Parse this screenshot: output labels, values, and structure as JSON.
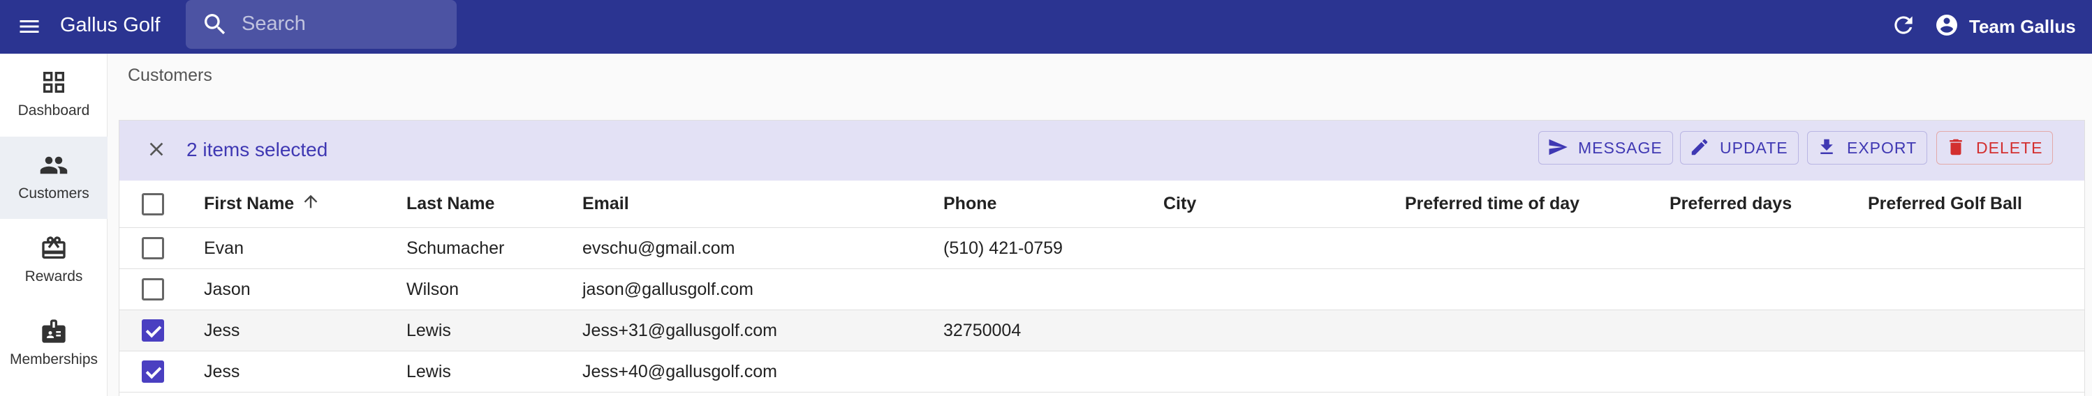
{
  "app": {
    "title": "Gallus Golf"
  },
  "search": {
    "placeholder": "Search",
    "value": ""
  },
  "user": {
    "name": "Team Gallus"
  },
  "sidebar": {
    "items": [
      {
        "label": "Dashboard",
        "icon": "dashboard-icon",
        "active": false
      },
      {
        "label": "Customers",
        "icon": "people-icon",
        "active": true
      },
      {
        "label": "Rewards",
        "icon": "gift-icon",
        "active": false
      },
      {
        "label": "Memberships",
        "icon": "badge-icon",
        "active": false
      }
    ]
  },
  "breadcrumb": "Customers",
  "bulk": {
    "count_label": "2 items selected",
    "actions": [
      {
        "label": "MESSAGE",
        "icon": "send-icon"
      },
      {
        "label": "UPDATE",
        "icon": "edit-icon"
      },
      {
        "label": "EXPORT",
        "icon": "download-icon"
      },
      {
        "label": "DELETE",
        "icon": "trash-icon",
        "color": "#d32f2f"
      }
    ]
  },
  "colors": {
    "appbar": "#2b3491",
    "accent": "#4a3fc1",
    "danger": "#d32f2f",
    "bulkbar": "#e3e1f5"
  },
  "table": {
    "columns": [
      "First Name",
      "Last Name",
      "Email",
      "Phone",
      "City",
      "Preferred time of day",
      "Preferred days",
      "Preferred Golf Ball"
    ],
    "sort": {
      "column": "First Name",
      "direction": "ascending"
    },
    "rows": [
      {
        "selected": false,
        "first": "Evan",
        "last": "Schumacher",
        "email": "evschu@gmail.com",
        "phone": "(510) 421-0759",
        "city": "",
        "time": "",
        "days": "",
        "ball": ""
      },
      {
        "selected": false,
        "first": "Jason",
        "last": "Wilson",
        "email": "jason@gallusgolf.com",
        "phone": "",
        "city": "",
        "time": "",
        "days": "",
        "ball": ""
      },
      {
        "selected": true,
        "first": "Jess",
        "last": "Lewis",
        "email": "Jess+31@gallusgolf.com",
        "phone": "32750004",
        "city": "",
        "time": "",
        "days": "",
        "ball": ""
      },
      {
        "selected": true,
        "first": "Jess",
        "last": "Lewis",
        "email": "Jess+40@gallusgolf.com",
        "phone": "",
        "city": "",
        "time": "",
        "days": "",
        "ball": ""
      }
    ]
  }
}
